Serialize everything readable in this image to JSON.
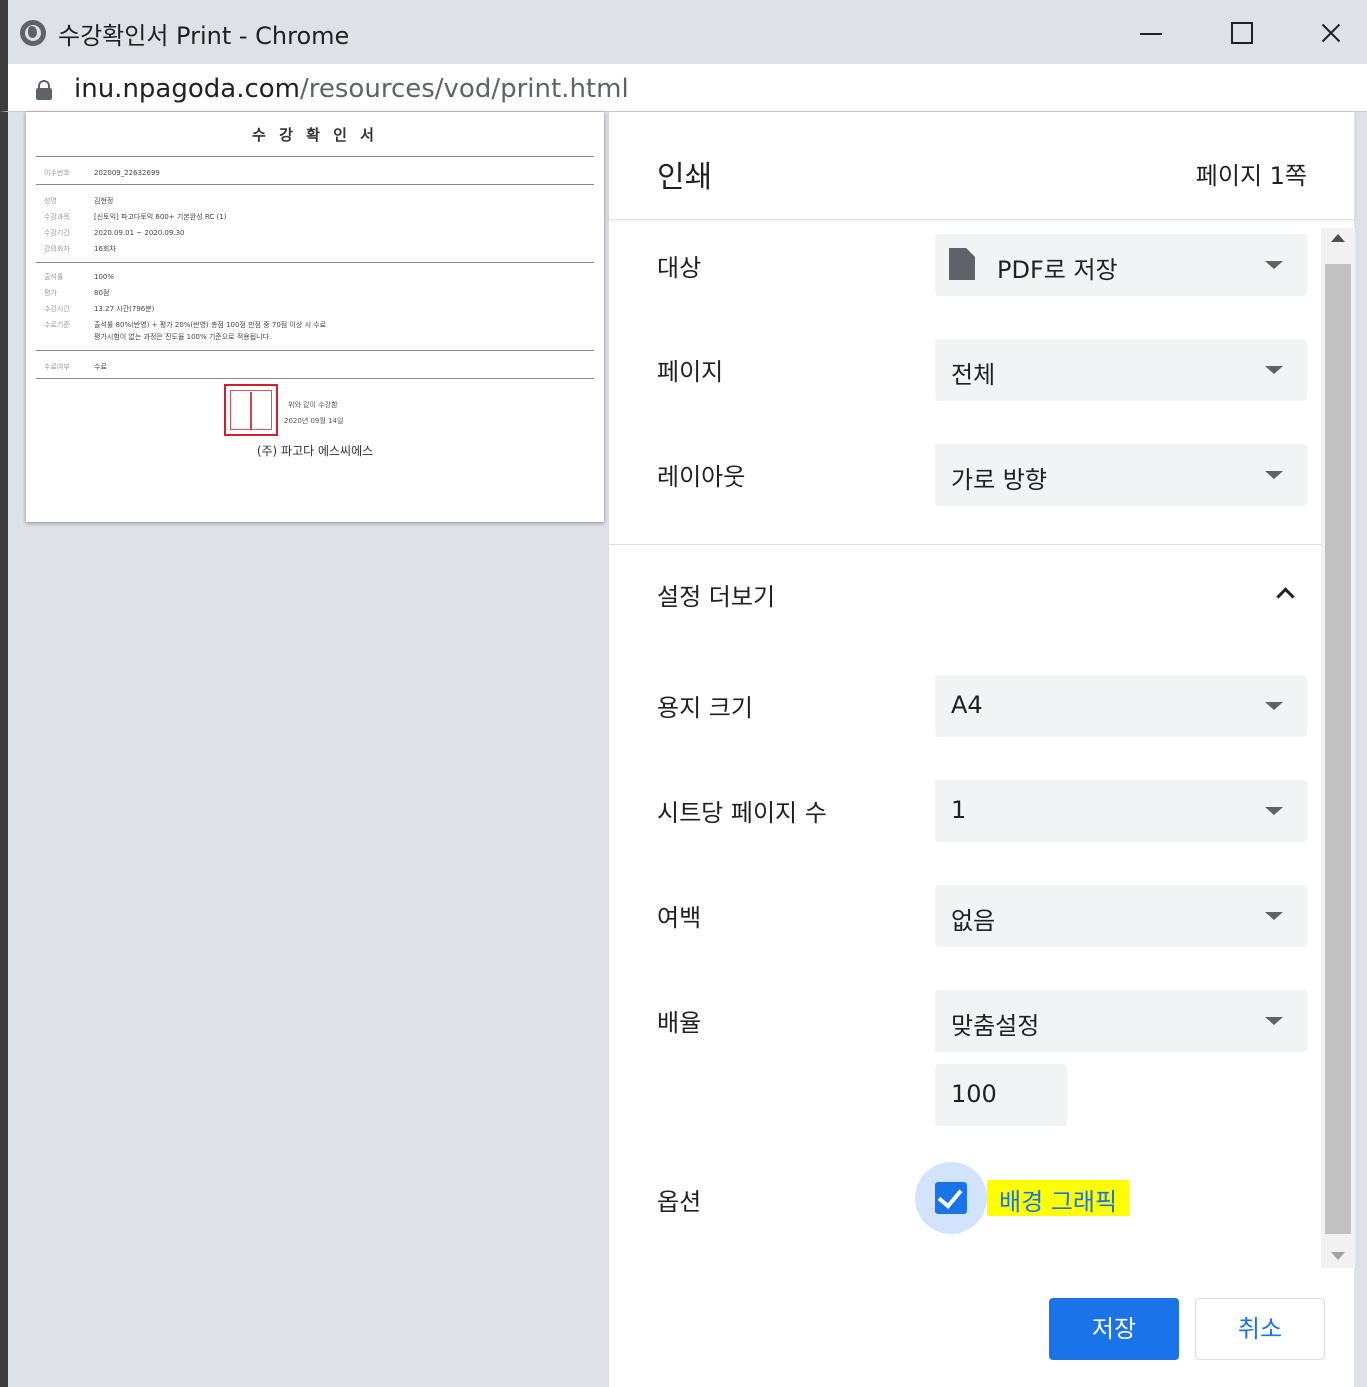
{
  "window": {
    "title": "수강확인서 Print - Chrome",
    "url_host": "inu.npagoda.com",
    "url_path": "/resources/vod/print.html"
  },
  "preview": {
    "doc_title": "수 강 확 인 서",
    "rows": [
      {
        "key": "이수번호",
        "value": "202009_22632699"
      },
      {
        "key": "성명",
        "value": "김현정"
      },
      {
        "key": "수강과목",
        "value": "[신토익] 파고다토익 600+ 기본완성 RC (1)"
      },
      {
        "key": "수강기간",
        "value": "2020.09.01 ~ 2020.09.30"
      },
      {
        "key": "강의회차",
        "value": "16회차"
      },
      {
        "key": "출석률",
        "value": "100%"
      },
      {
        "key": "평가",
        "value": "80점"
      },
      {
        "key": "수강시간",
        "value": "13.27 시간(796분)"
      },
      {
        "key": "수료기준",
        "value": "출석률 80%(반영) + 평가 20%(반영) 총점 100점 만점 중 70점 이상 시 수료"
      },
      {
        "key": "",
        "value": "평가시험이 없는 과정은 진도율 100% 기준으로 적용됩니다."
      },
      {
        "key": "수료여부",
        "value": "수료"
      }
    ],
    "sign_line1": "위와 같이 수강함",
    "sign_line2": "2020년 09월 14일",
    "company": "(주) 파고다 에스씨에스"
  },
  "panel": {
    "title": "인쇄",
    "page_count": "페이지 1쪽",
    "destination_label": "대상",
    "destination_value": "PDF로 저장",
    "destination_icon": "pdf-file-icon",
    "pages_label": "페이지",
    "pages_value": "전체",
    "layout_label": "레이아웃",
    "layout_value": "가로 방향",
    "more_settings_label": "설정 더보기",
    "paper_label": "용지 크기",
    "paper_value": "A4",
    "pps_label": "시트당 페이지 수",
    "pps_value": "1",
    "margins_label": "여백",
    "margins_value": "없음",
    "scale_label": "배율",
    "scale_value": "맞춤설정",
    "scale_number": "100",
    "options_label": "옵션",
    "background_graphics_label": "배경 그래픽",
    "background_graphics_checked": true,
    "save_button": "저장",
    "cancel_button": "취소"
  },
  "colors": {
    "accent": "#1a73e8",
    "highlight": "#ffff00",
    "select_bg": "#f1f3f4"
  }
}
